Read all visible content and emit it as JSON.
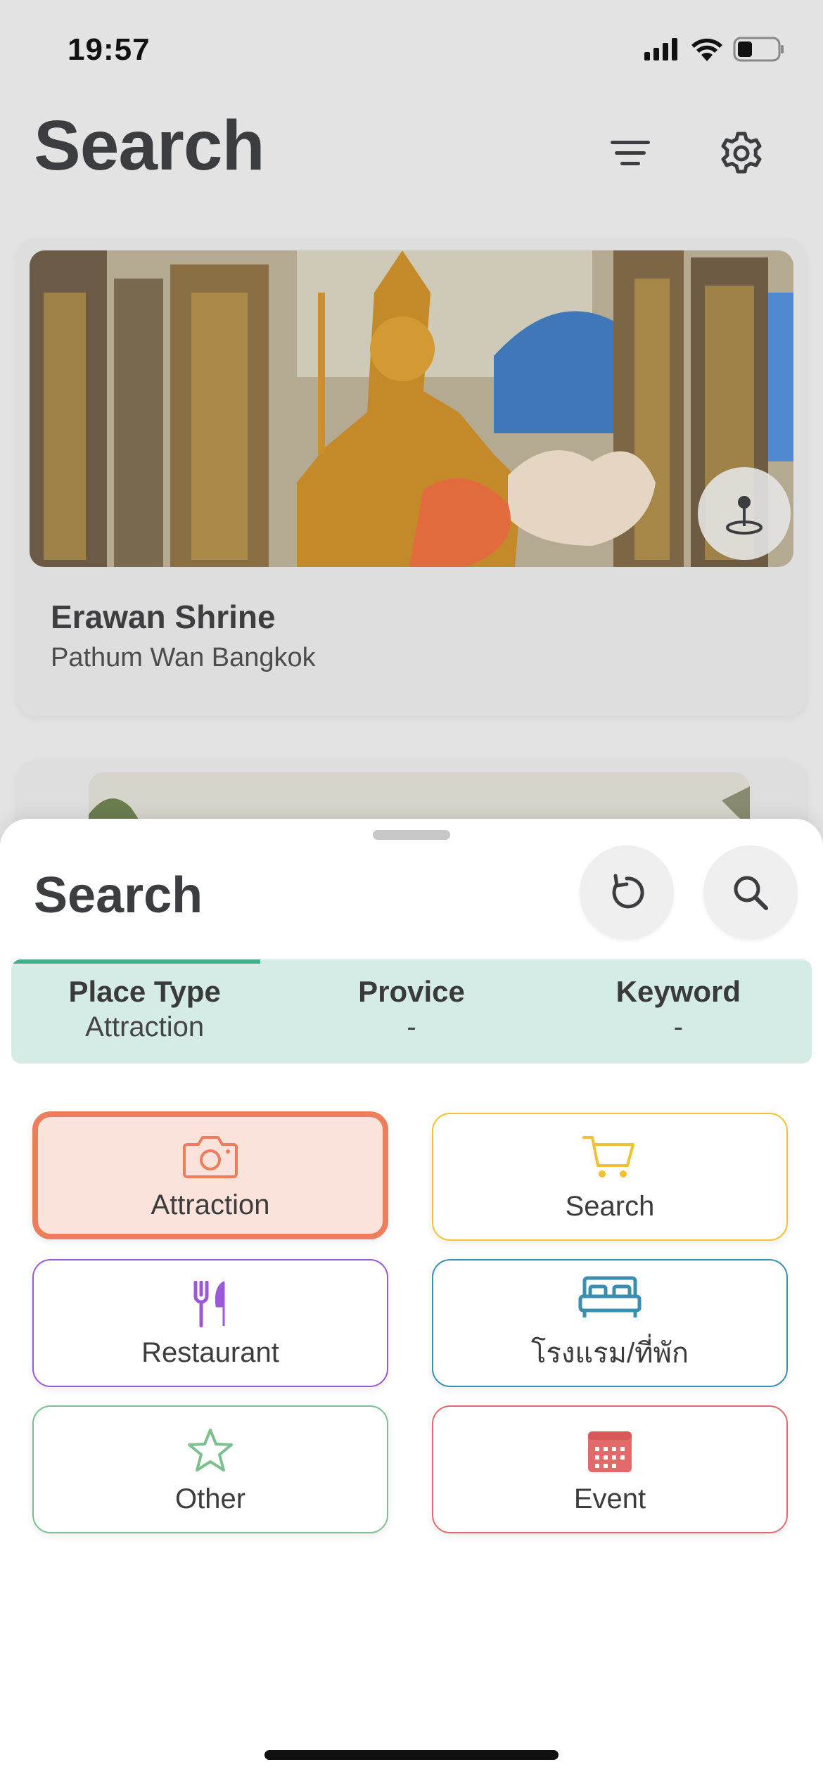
{
  "status_bar": {
    "time": "19:57"
  },
  "header": {
    "title": "Search",
    "filter_icon": "filter-lines-icon",
    "settings_icon": "gear-icon"
  },
  "cards": [
    {
      "title": "Erawan Shrine",
      "subtitle": "Pathum Wan Bangkok",
      "image_alt": "Erawan Shrine photo",
      "map_icon": "map-pin-icon"
    },
    {
      "title": "",
      "subtitle": ""
    }
  ],
  "sheet": {
    "title": "Search",
    "reset_icon": "reset-icon",
    "search_icon": "search-icon",
    "tabs": [
      {
        "label": "Place Type",
        "value": "Attraction"
      },
      {
        "label": "Provice",
        "value": "-"
      },
      {
        "label": "Keyword",
        "value": "-"
      }
    ],
    "place_types": [
      {
        "label": "Attraction",
        "icon": "camera-icon",
        "color": "#ee7d5b",
        "selected": true
      },
      {
        "label": "Search",
        "icon": "cart-icon",
        "color": "#f2c12e",
        "selected": false
      },
      {
        "label": "Restaurant",
        "icon": "utensils-icon",
        "color": "#9b59d6",
        "selected": false
      },
      {
        "label": "โรงแรม/ที่พัก",
        "icon": "bed-icon",
        "color": "#3a8fb0",
        "selected": false
      },
      {
        "label": "Other",
        "icon": "star-icon",
        "color": "#7dbf8e",
        "selected": false
      },
      {
        "label": "Event",
        "icon": "calendar-icon",
        "color": "#e26a6a",
        "selected": false
      }
    ]
  },
  "colors": {
    "accent_teal": "#3fb08a",
    "tab_bg": "#d5ece6",
    "selected_bg": "#fbe3dc"
  }
}
